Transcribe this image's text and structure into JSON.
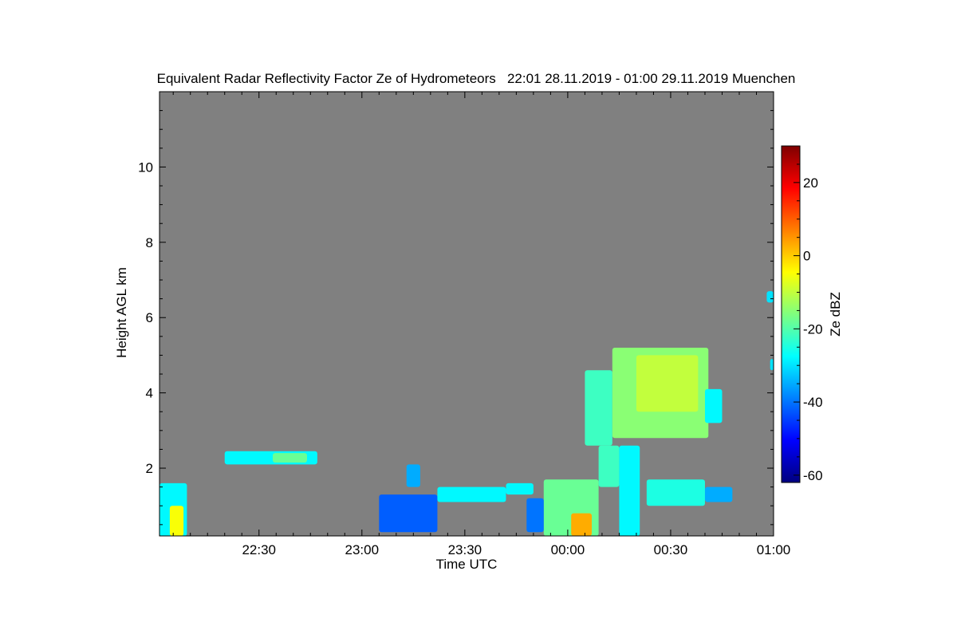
{
  "chart_data": {
    "type": "heatmap",
    "title": "Equivalent Radar Reflectivity Factor Ze of Hydrometeors   22:01 28.11.2019 - 01:00 29.11.2019 Muenchen",
    "xlabel": "Time UTC",
    "ylabel": "Height AGL km",
    "x_ticks": [
      "22:30",
      "23:00",
      "23:30",
      "00:00",
      "00:30",
      "01:00"
    ],
    "x_tick_minutes": [
      30,
      60,
      90,
      120,
      150,
      180
    ],
    "xlim_minutes": [
      1,
      180
    ],
    "y_ticks": [
      2,
      4,
      6,
      8,
      10
    ],
    "ylim": [
      0.2,
      12.0
    ],
    "background_color": "#808080",
    "colorbar": {
      "label": "Ze dBZ",
      "ticks": [
        -60,
        -40,
        -20,
        0,
        20
      ],
      "range": [
        -62,
        30
      ],
      "colormap": [
        "#00007f",
        "#0000ff",
        "#007fff",
        "#00ffff",
        "#7fff7f",
        "#ffff00",
        "#ff7f00",
        "#ff0000",
        "#7f0000"
      ]
    },
    "echo_regions": [
      {
        "t0": 1,
        "t1": 9,
        "h0": 0.2,
        "h1": 1.6,
        "dbz": -28
      },
      {
        "t0": 4,
        "t1": 8,
        "h0": 0.2,
        "h1": 1.0,
        "dbz": -5
      },
      {
        "t0": 20,
        "t1": 47,
        "h0": 2.1,
        "h1": 2.45,
        "dbz": -28
      },
      {
        "t0": 34,
        "t1": 44,
        "h0": 2.15,
        "h1": 2.4,
        "dbz": -18
      },
      {
        "t0": 65,
        "t1": 82,
        "h0": 0.3,
        "h1": 1.3,
        "dbz": -42
      },
      {
        "t0": 82,
        "t1": 102,
        "h0": 1.1,
        "h1": 1.5,
        "dbz": -28
      },
      {
        "t0": 102,
        "t1": 110,
        "h0": 1.3,
        "h1": 1.6,
        "dbz": -28
      },
      {
        "t0": 73,
        "t1": 77,
        "h0": 1.5,
        "h1": 2.1,
        "dbz": -35
      },
      {
        "t0": 113,
        "t1": 129,
        "h0": 0.2,
        "h1": 1.7,
        "dbz": -18
      },
      {
        "t0": 108,
        "t1": 113,
        "h0": 0.3,
        "h1": 1.2,
        "dbz": -40
      },
      {
        "t0": 121,
        "t1": 127,
        "h0": 0.2,
        "h1": 0.8,
        "dbz": 3
      },
      {
        "t0": 129,
        "t1": 135,
        "h0": 1.5,
        "h1": 2.6,
        "dbz": -22
      },
      {
        "t0": 135,
        "t1": 141,
        "h0": 0.2,
        "h1": 2.6,
        "dbz": -28
      },
      {
        "t0": 125,
        "t1": 133,
        "h0": 2.6,
        "h1": 4.6,
        "dbz": -22
      },
      {
        "t0": 133,
        "t1": 161,
        "h0": 2.8,
        "h1": 5.2,
        "dbz": -15
      },
      {
        "t0": 140,
        "t1": 158,
        "h0": 3.5,
        "h1": 5.0,
        "dbz": -10
      },
      {
        "t0": 160,
        "t1": 165,
        "h0": 3.2,
        "h1": 4.1,
        "dbz": -28
      },
      {
        "t0": 143,
        "t1": 160,
        "h0": 1.0,
        "h1": 1.7,
        "dbz": -25
      },
      {
        "t0": 160,
        "t1": 168,
        "h0": 1.1,
        "h1": 1.5,
        "dbz": -35
      },
      {
        "t0": 178,
        "t1": 180,
        "h0": 6.4,
        "h1": 6.7,
        "dbz": -30
      },
      {
        "t0": 179,
        "t1": 180,
        "h0": 4.6,
        "h1": 4.9,
        "dbz": -30
      }
    ]
  }
}
